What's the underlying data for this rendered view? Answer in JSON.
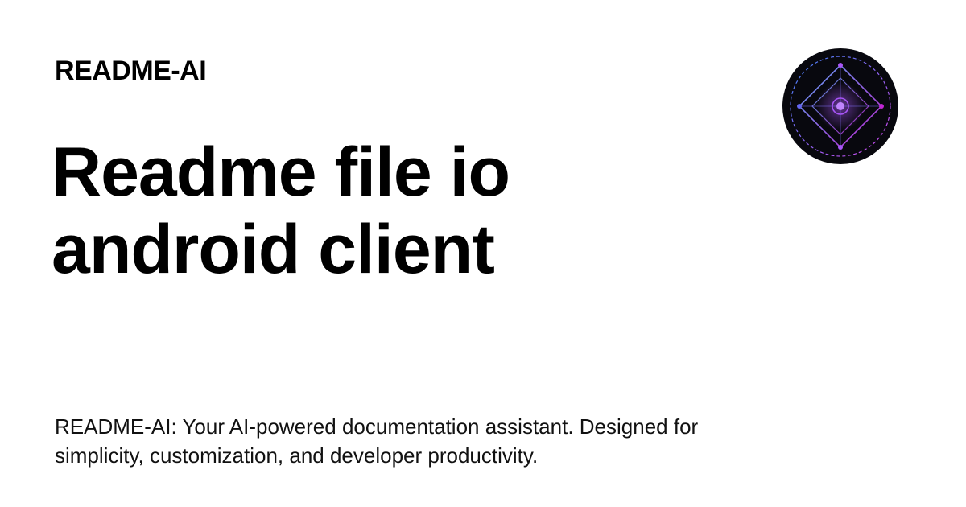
{
  "brand": {
    "name": "README-AI"
  },
  "hero": {
    "title_line_1": "Readme file io",
    "title_line_2": "android client"
  },
  "description": {
    "text": "README-AI: Your AI-powered documentation assistant. Designed for simplicity, customization, and developer productivity."
  },
  "logo": {
    "icon": "diamond-target-icon",
    "colors": {
      "background": "#08080e",
      "blue": "#3b82f6",
      "purple": "#a855f7",
      "magenta": "#d946ef"
    }
  }
}
